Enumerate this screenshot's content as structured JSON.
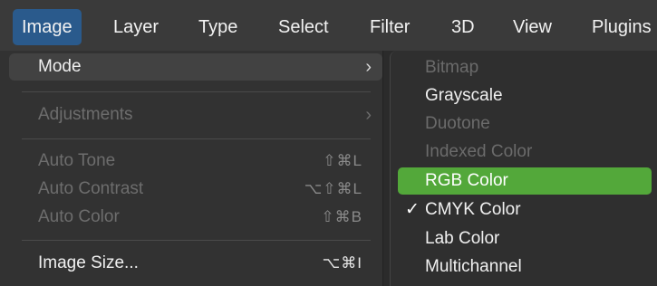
{
  "menubar": {
    "items": [
      "Image",
      "Layer",
      "Type",
      "Select",
      "Filter",
      "3D",
      "View",
      "Plugins"
    ]
  },
  "image_menu": {
    "mode": {
      "label": "Mode",
      "chevron": "›"
    },
    "adjustments": {
      "label": "Adjustments",
      "chevron": "›"
    },
    "auto_tone": {
      "label": "Auto Tone",
      "shortcut": "⇧⌘L"
    },
    "auto_contrast": {
      "label": "Auto Contrast",
      "shortcut": "⌥⇧⌘L"
    },
    "auto_color": {
      "label": "Auto Color",
      "shortcut": "⇧⌘B"
    },
    "image_size": {
      "label": "Image Size...",
      "shortcut": "⌥⌘I"
    }
  },
  "mode_submenu": {
    "check_mark": "✓",
    "items": [
      "Bitmap",
      "Grayscale",
      "Duotone",
      "Indexed Color",
      "RGB Color",
      "CMYK Color",
      "Lab Color",
      "Multichannel"
    ],
    "disabled": [
      "Bitmap",
      "Duotone",
      "Indexed Color"
    ],
    "highlighted": "RGB Color",
    "checked": "CMYK Color"
  },
  "colors": {
    "menubar_active": "#2a5a8c",
    "submenu_highlight": "#53a83a",
    "menu_background": "#323232"
  }
}
